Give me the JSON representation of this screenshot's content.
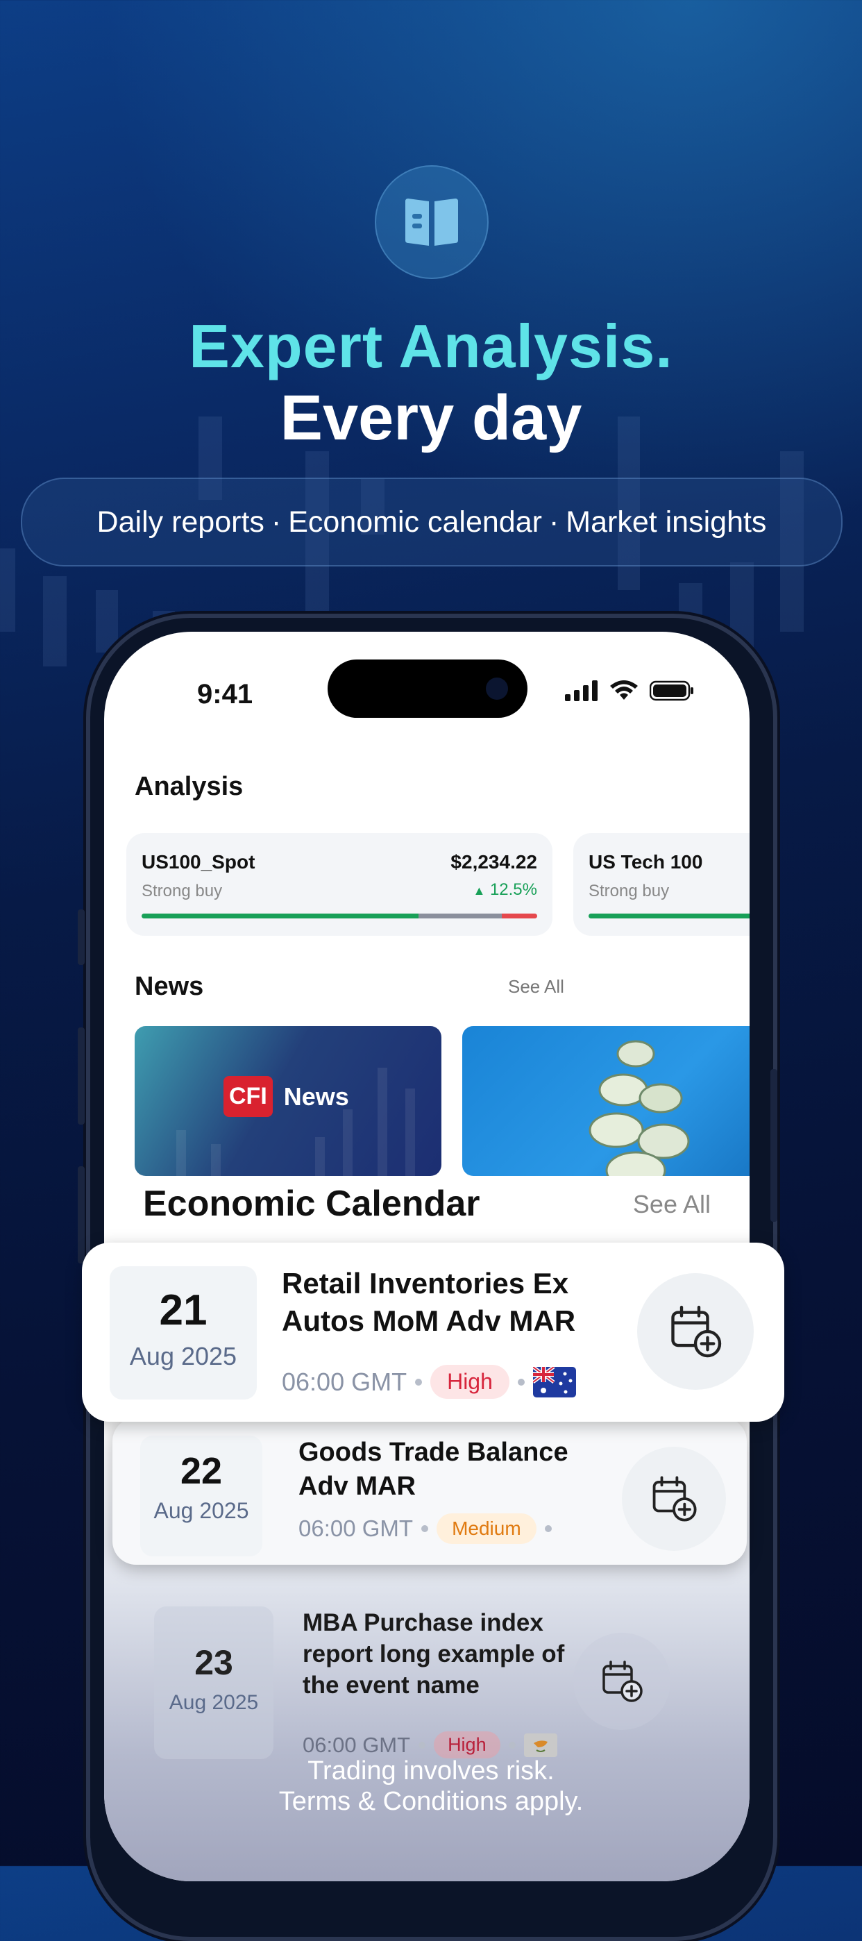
{
  "hero": {
    "icon": "book-icon",
    "title": "Expert Analysis.",
    "subtitle": "Every day",
    "features": [
      "Daily reports",
      "Economic calendar",
      "Market insights"
    ],
    "separator": "·"
  },
  "status_bar": {
    "time": "9:41"
  },
  "analysis": {
    "title": "Analysis",
    "cards": [
      {
        "symbol": "US100_Spot",
        "rating": "Strong buy",
        "price": "$2,234.22",
        "change": "12.5%",
        "change_dir": "up"
      },
      {
        "symbol": "US Tech 100",
        "rating": "Strong buy"
      }
    ]
  },
  "news": {
    "title": "News",
    "see_all": "See All",
    "cards": [
      {
        "badge": "CFI",
        "label": "News"
      },
      {
        "image": "money-rolls"
      }
    ]
  },
  "calendar": {
    "title": "Economic Calendar",
    "see_all": "See All",
    "events": [
      {
        "day": "21",
        "month": "Aug 2025",
        "name": "Retail Inventories Ex Autos MoM Adv MAR",
        "time": "06:00 GMT",
        "impact": "High",
        "flag": "australia-flag-icon"
      },
      {
        "day": "22",
        "month": "Aug 2025",
        "name": "Goods Trade Balance Adv MAR",
        "time": "06:00 GMT",
        "impact": "Medium"
      },
      {
        "day": "23",
        "month": "Aug 2025",
        "name": "MBA Purchase index report long example of the event name",
        "time": "06:00 GMT",
        "impact": "High",
        "flag": "cyprus-flag-icon"
      }
    ]
  },
  "disclaimer": {
    "line1": "Trading involves risk.",
    "line2": "Terms & Conditions apply."
  },
  "colors": {
    "accent_cyan": "#5fe3e8",
    "buy_green": "#18a058",
    "sell_red": "#e5484d",
    "neutral_gray": "#8a8f9c",
    "high_red": "#d7263d",
    "medium_orange": "#e07a10"
  }
}
